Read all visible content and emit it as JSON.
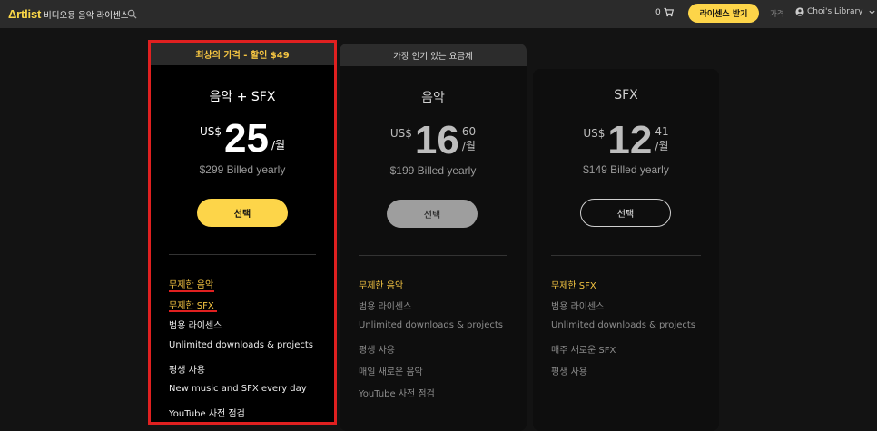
{
  "topbar": {
    "logo": "Δrtlist",
    "tagline": "비디오용 음악 라이센스",
    "cart_count": "0",
    "license_button": "라이센스 받기",
    "nav_price": "가격",
    "account_name": "Choi's Library",
    "accent_color": "#fdd549"
  },
  "plans": [
    {
      "banner": "최상의 가격 - 할인 $49",
      "name": "음악 + SFX",
      "currency": "US$",
      "price_whole": "25",
      "price_cents": "",
      "per": "/월",
      "billed": "$299 Billed yearly",
      "select_label": "선택",
      "features": [
        "무제한 음악",
        "무제한 SFX",
        "범용 라이센스",
        "Unlimited downloads & projects",
        "평생 사용",
        "New music and SFX every day",
        "YouTube 사전 점검"
      ]
    },
    {
      "banner": "가장 인기 있는 요금제",
      "name": "음악",
      "currency": "US$",
      "price_whole": "16",
      "price_cents": "60",
      "per": "/월",
      "billed": "$199 Billed yearly",
      "select_label": "선택",
      "features": [
        "무제한 음악",
        "범용 라이센스",
        "Unlimited downloads & projects",
        "평생 사용",
        "매일 새로운 음악",
        "YouTube 사전 점검"
      ]
    },
    {
      "name": "SFX",
      "currency": "US$",
      "price_whole": "12",
      "price_cents": "41",
      "per": "/월",
      "billed": "$149 Billed yearly",
      "select_label": "선택",
      "features": [
        "무제한 SFX",
        "범용 라이센스",
        "Unlimited downloads & projects",
        "매주 새로운 SFX",
        "평생 사용"
      ]
    }
  ]
}
